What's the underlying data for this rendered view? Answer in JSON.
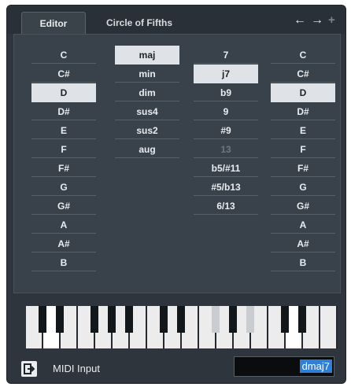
{
  "tabs": {
    "editor": "Editor",
    "circle": "Circle of Fifths",
    "prev": "←",
    "next": "→",
    "add": "+"
  },
  "root_notes": [
    "C",
    "C#",
    "D",
    "D#",
    "E",
    "F",
    "F#",
    "G",
    "G#",
    "A",
    "A#",
    "B"
  ],
  "chord_types": [
    "maj",
    "min",
    "dim",
    "sus4",
    "sus2",
    "aug"
  ],
  "tensions": [
    "7",
    "j7",
    "b9",
    "9",
    "#9",
    "13",
    "b5/#11",
    "#5/b13",
    "6/13"
  ],
  "bass_notes": [
    "C",
    "C#",
    "D",
    "D#",
    "E",
    "F",
    "F#",
    "G",
    "G#",
    "A",
    "A#",
    "B"
  ],
  "selected": {
    "root": "D",
    "type": "maj",
    "tension": "j7",
    "bass": "D",
    "disabled_tension": "13"
  },
  "midi": {
    "label": "MIDI Input",
    "chord_value": "dmaj7"
  },
  "colors": {
    "panel_bg": "#2e353c",
    "editor_bg": "#39414a",
    "selected_bg": "#dfe3e7",
    "highlight_blue": "#2f7ed8"
  }
}
